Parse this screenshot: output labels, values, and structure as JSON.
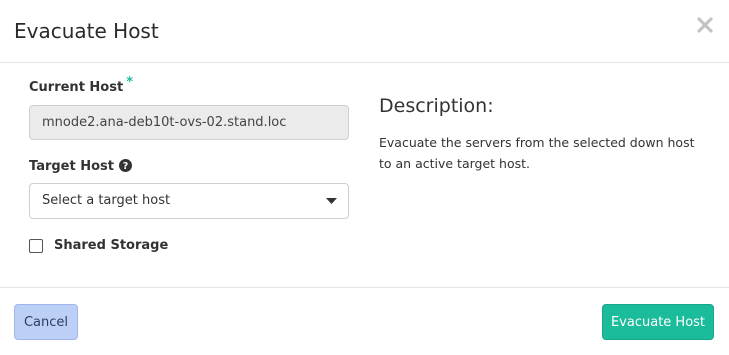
{
  "dialog": {
    "title": "Evacuate Host"
  },
  "form": {
    "current_host": {
      "label": "Current Host",
      "required_marker": "*",
      "value": "mnode2.ana-deb10t-ovs-02.stand.loc"
    },
    "target_host": {
      "label": "Target Host",
      "selected": "Select a target host"
    },
    "shared_storage": {
      "label": "Shared Storage",
      "checked": false
    }
  },
  "description": {
    "title": "Description:",
    "text": "Evacuate the servers from the selected down host to an active target host."
  },
  "footer": {
    "cancel_label": "Cancel",
    "submit_label": "Evacuate Host"
  },
  "colors": {
    "accent": "#1abc9c",
    "cancel_bg": "#bcd0f7"
  }
}
